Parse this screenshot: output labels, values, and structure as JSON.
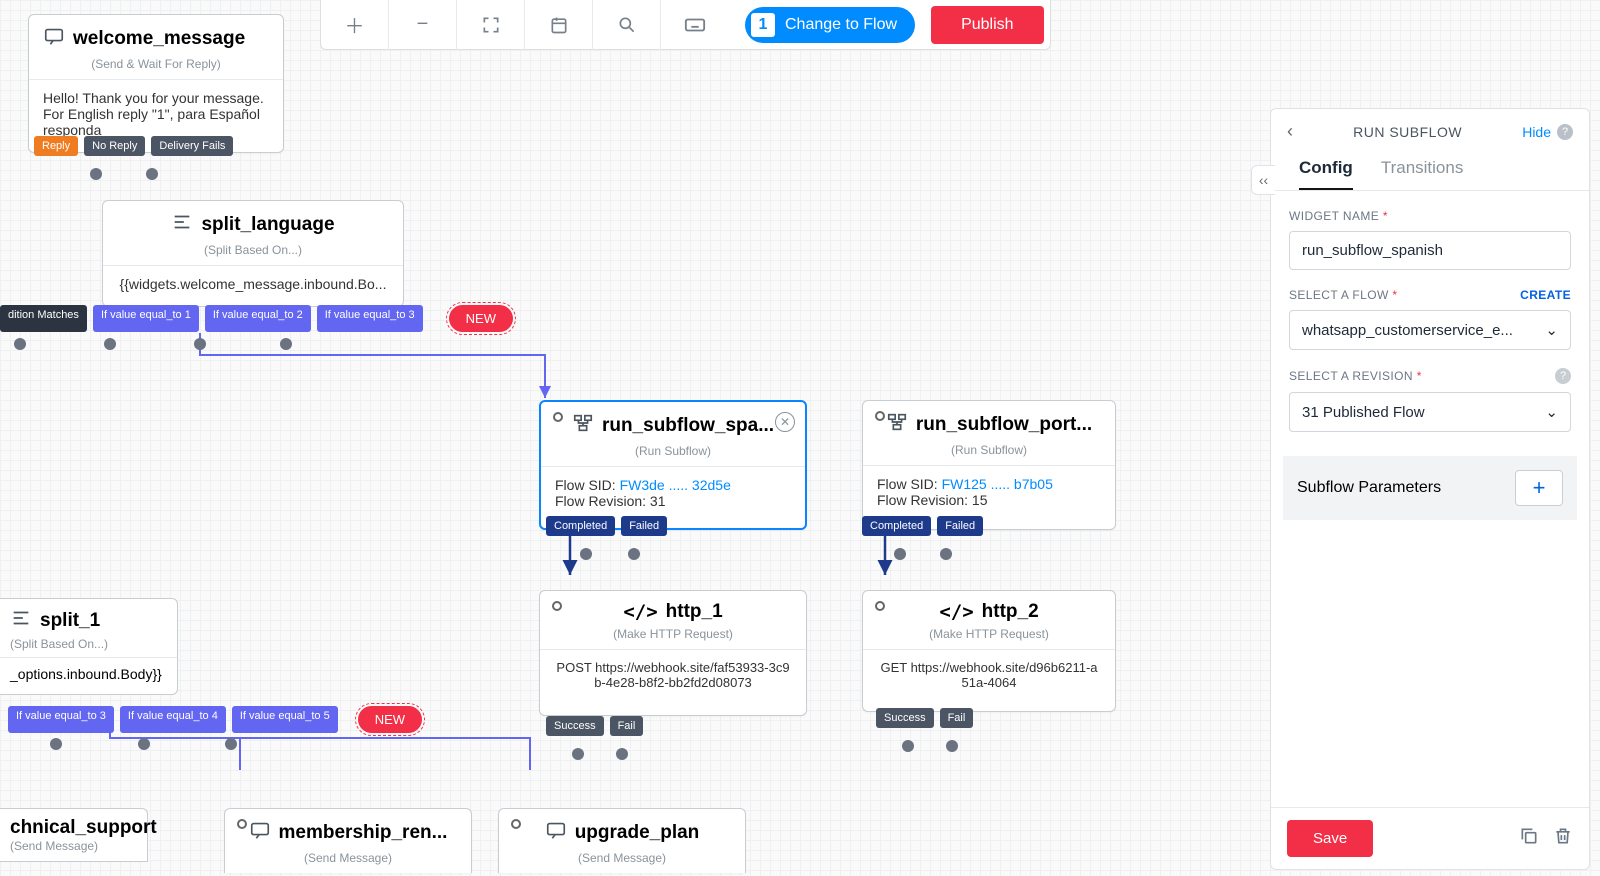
{
  "toolbar": {
    "change_flow_badge": "1",
    "change_flow_label": "Change to Flow",
    "publish_label": "Publish"
  },
  "widgets": {
    "welcome": {
      "name": "welcome_message",
      "subtitle": "(Send & Wait For Reply)",
      "body": "Hello! Thank you for your message. For English reply \"1\", para Español responda",
      "pills": [
        "Reply",
        "No Reply",
        "Delivery Fails"
      ]
    },
    "split_language": {
      "name": "split_language",
      "subtitle": "(Split Based On...)",
      "body": "{{widgets.welcome_message.inbound.Bo...",
      "pills": [
        "dition Matches",
        "If value equal_to 1",
        "If value equal_to 2",
        "If value equal_to 3"
      ],
      "new_label": "NEW"
    },
    "run_subflow_spanish": {
      "name": "run_subflow_spa...",
      "subtitle": "(Run Subflow)",
      "sid_label": "Flow SID: ",
      "sid_value": "FW3de ..... 32d5e",
      "rev_label": "Flow Revision: 31",
      "pills": [
        "Completed",
        "Failed"
      ]
    },
    "run_subflow_port": {
      "name": "run_subflow_port...",
      "subtitle": "(Run Subflow)",
      "sid_label": "Flow SID: ",
      "sid_value": "FW125 ..... b7b05",
      "rev_label": "Flow Revision: 15",
      "pills": [
        "Completed",
        "Failed"
      ]
    },
    "http_1": {
      "name": "http_1",
      "subtitle": "(Make HTTP Request)",
      "body": "POST https://webhook.site/faf53933-3c9b-4e28-b8f2-bb2fd2d08073",
      "pills": [
        "Success",
        "Fail"
      ]
    },
    "http_2": {
      "name": "http_2",
      "subtitle": "(Make HTTP Request)",
      "body": "GET https://webhook.site/d96b6211-a51a-4064",
      "pills": [
        "Success",
        "Fail"
      ]
    },
    "split_1": {
      "name": "split_1",
      "subtitle": "(Split Based On...)",
      "body": "_options.inbound.Body}}",
      "pills": [
        "If value equal_to 3",
        "If value equal_to 4",
        "If value equal_to 5"
      ],
      "new_label": "NEW"
    },
    "technical_support": {
      "name": "chnical_support",
      "subtitle": "(Send Message)"
    },
    "membership_ren": {
      "name": "membership_ren...",
      "subtitle": "(Send Message)"
    },
    "upgrade_plan": {
      "name": "upgrade_plan",
      "subtitle": "(Send Message)"
    }
  },
  "panel": {
    "title": "RUN SUBFLOW",
    "hide_label": "Hide",
    "tabs": {
      "config": "Config",
      "transitions": "Transitions"
    },
    "widget_name_label": "WIDGET NAME",
    "widget_name_value": "run_subflow_spanish",
    "select_flow_label": "SELECT A FLOW",
    "create_label": "CREATE",
    "select_flow_value": "whatsapp_customerservice_e...",
    "select_revision_label": "SELECT A REVISION",
    "select_revision_value": "31 Published Flow",
    "subflow_params_label": "Subflow Parameters",
    "save_label": "Save"
  }
}
